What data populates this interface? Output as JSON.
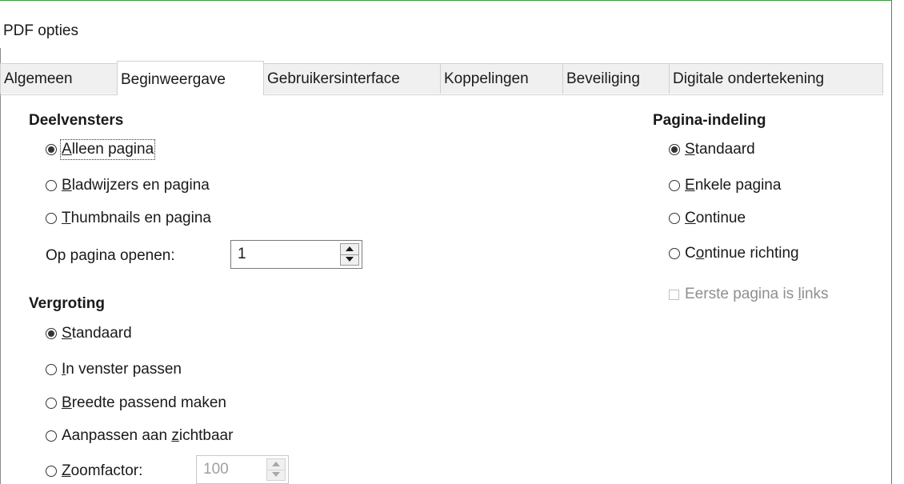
{
  "dialog": {
    "title": "PDF opties"
  },
  "tabs": [
    {
      "label": "Algemeen"
    },
    {
      "label": "Beginweergave"
    },
    {
      "label": "Gebruikersinterface"
    },
    {
      "label": "Koppelingen"
    },
    {
      "label": "Beveiliging"
    },
    {
      "label": "Digitale ondertekening"
    }
  ],
  "active_tab": "Beginweergave",
  "panes": {
    "title": "Deelvensters",
    "options": [
      {
        "pre": "",
        "key": "A",
        "post": "lleen pagina",
        "checked": true
      },
      {
        "pre": "",
        "key": "B",
        "post": "ladwijzers en pagina",
        "checked": false
      },
      {
        "pre": "",
        "key": "T",
        "post": "humbnails en pagina",
        "checked": false
      }
    ],
    "open_page": {
      "pre": "Op pa",
      "key": "g",
      "post": "ina openen:",
      "value": "1"
    }
  },
  "magnification": {
    "title": "Vergroting",
    "options": [
      {
        "pre": "",
        "key": "S",
        "post": "tandaard",
        "checked": true
      },
      {
        "pre": "",
        "key": "I",
        "post": "n venster passen",
        "checked": false
      },
      {
        "pre": "",
        "key": "B",
        "post": "reedte passend maken",
        "checked": false
      },
      {
        "pre": "Aanpassen aan ",
        "key": "z",
        "post": "ichtbaar",
        "checked": false
      }
    ],
    "zoom": {
      "pre": "",
      "key": "Z",
      "post": "oomfactor:",
      "value": "100",
      "checked": false
    }
  },
  "page_layout": {
    "title": "Pagina-indeling",
    "options": [
      {
        "pre": "",
        "key": "S",
        "post": "tandaard",
        "checked": true
      },
      {
        "pre": "",
        "key": "E",
        "post": "nkele pagina",
        "checked": false
      },
      {
        "pre": "",
        "key": "C",
        "post": "ontinue",
        "checked": false
      },
      {
        "pre": "C",
        "key": "o",
        "post": "ntinue richting",
        "checked": false
      }
    ],
    "first_left": {
      "pre": "Eerste pagina is ",
      "key": "l",
      "post": "inks",
      "checked": false
    }
  },
  "colors": {
    "frame_green": "#3a9a3a",
    "tab_inactive": "#f0f0f0",
    "disabled_text": "#8f8f8f"
  }
}
